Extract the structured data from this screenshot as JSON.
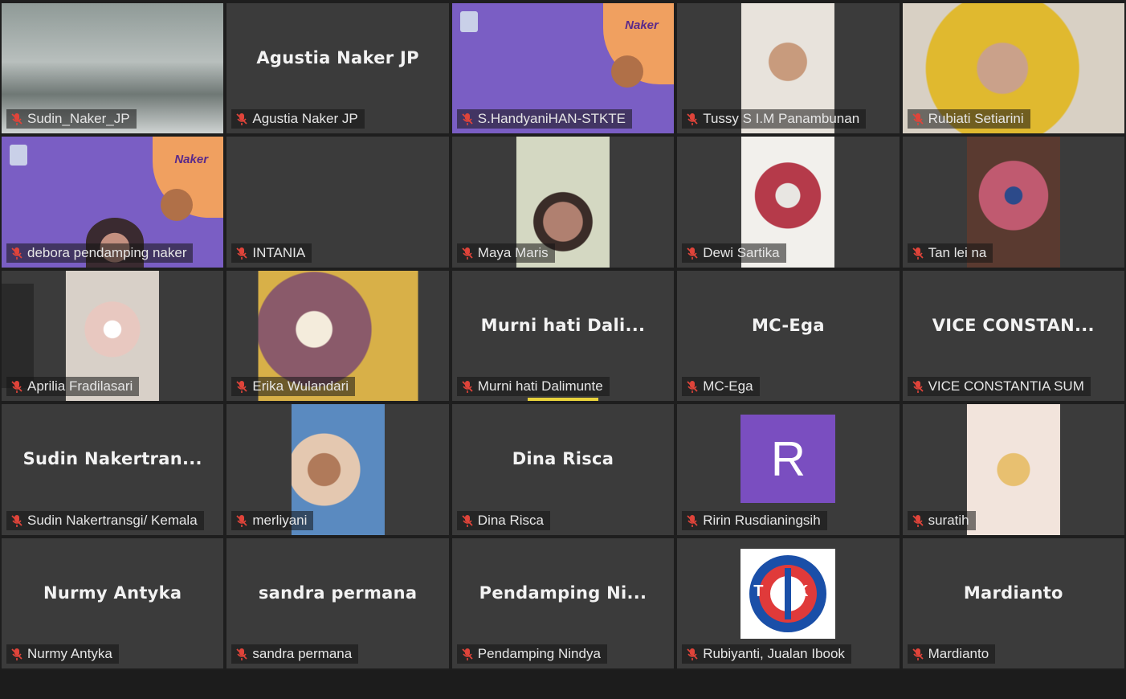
{
  "tiles": [
    {
      "label": "Sudin_Naker_JP",
      "center": "",
      "kind": "video",
      "video": "kitchen",
      "active": true
    },
    {
      "label": "Agustia Naker JP",
      "center": "Agustia Naker JP",
      "kind": "name"
    },
    {
      "label": "S.HandyaniHAN-STKTE",
      "center": "",
      "kind": "slide"
    },
    {
      "label": "Tussy S I.M Panambunan",
      "center": "",
      "kind": "video",
      "video": "face1"
    },
    {
      "label": "Rubiati Setiarini",
      "center": "",
      "kind": "video",
      "video": "hijab-yellow",
      "full": true
    },
    {
      "label": "debora pendamping naker",
      "center": "",
      "kind": "slide",
      "person": true
    },
    {
      "label": "INTANIA",
      "center": "",
      "kind": "name"
    },
    {
      "label": "Maya Maris",
      "center": "",
      "kind": "video",
      "video": "maya"
    },
    {
      "label": "Dewi Sartika",
      "center": "",
      "kind": "video",
      "video": "dewi"
    },
    {
      "label": "Tan lei na",
      "center": "",
      "kind": "video",
      "video": "tan"
    },
    {
      "label": "Aprilia Fradilasari",
      "center": "",
      "kind": "video",
      "video": "aprilia",
      "handle": true
    },
    {
      "label": "Erika Wulandari",
      "center": "",
      "kind": "video",
      "video": "erika",
      "wide": true
    },
    {
      "label": "Murni hati Dalimunte",
      "center": "Murni hati Dali...",
      "kind": "name",
      "speaking": true
    },
    {
      "label": "MC-Ega",
      "center": "MC-Ega",
      "kind": "name"
    },
    {
      "label": "VICE CONSTANTIA SUM",
      "center": "VICE CONSTAN...",
      "kind": "name"
    },
    {
      "label": "Sudin Nakertransgi/ Kemala",
      "center": "Sudin Nakertran...",
      "kind": "name"
    },
    {
      "label": "merliyani",
      "center": "",
      "kind": "video",
      "video": "merliyani"
    },
    {
      "label": "Dina Risca",
      "center": "Dina Risca",
      "kind": "name"
    },
    {
      "label": "Ririn Rusdianingsih",
      "center": "",
      "kind": "avatar",
      "avatar_letter": "R"
    },
    {
      "label": "suratih",
      "center": "",
      "kind": "video",
      "video": "suratih"
    },
    {
      "label": "Nurmy Antyka",
      "center": "Nurmy Antyka",
      "kind": "name"
    },
    {
      "label": "sandra permana",
      "center": "sandra permana",
      "kind": "name"
    },
    {
      "label": "Pendamping Nindya",
      "center": "Pendamping Ni...",
      "kind": "name"
    },
    {
      "label": "Rubiyanti, Jualan Ibook",
      "center": "",
      "kind": "logo",
      "logo_letters": "T K"
    },
    {
      "label": "Mardianto",
      "center": "Mardianto",
      "kind": "name"
    }
  ],
  "slide_logo_text": "Naker",
  "colors": {
    "background": "#1e1e1e",
    "tile": "#3b3b3b",
    "active_border": "#c8e04a",
    "speaking_bar": "#e8d23c",
    "muted_mic": "#e0443a",
    "avatar_purple": "#7a4ec0"
  }
}
